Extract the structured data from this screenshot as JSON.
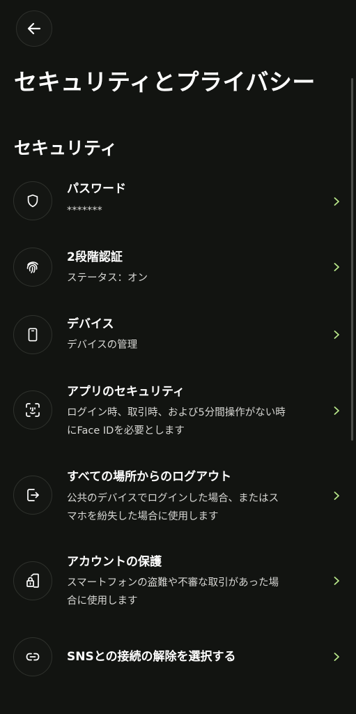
{
  "header": {
    "title": "セキュリティとプライバシー"
  },
  "section": {
    "title": "セキュリティ"
  },
  "items": [
    {
      "icon": "shield-icon",
      "title": "パスワード",
      "subtitle_lines": [
        "*******"
      ]
    },
    {
      "icon": "fingerprint-icon",
      "title": "2段階認証",
      "subtitle_lines": [
        "ステータス：オン"
      ]
    },
    {
      "icon": "phone-icon",
      "title": "デバイス",
      "subtitle_lines": [
        "デバイスの管理"
      ]
    },
    {
      "icon": "face-id-icon",
      "title": "アプリのセキュリティ",
      "subtitle_lines": [
        "ログイン時、取引時、および5分間操作がない時",
        "にFace IDを必要とします"
      ]
    },
    {
      "icon": "logout-icon",
      "title": "すべての場所からのログアウト",
      "subtitle_lines": [
        "公共のデバイスでログインした場合、またはス",
        "マホを紛失した場合に使用します"
      ]
    },
    {
      "icon": "account-protection-icon",
      "title": "アカウントの保護",
      "subtitle_lines": [
        "スマートフォンの盗難や不審な取引があった場",
        "合に使用します"
      ]
    },
    {
      "icon": "unlink-icon",
      "title": "SNSとの接続の解除を選択する",
      "subtitle_lines": []
    }
  ],
  "colors": {
    "background": "#121411",
    "chevron": "#b9e88a",
    "text": "#ffffff",
    "subtext": "#d8d8d5"
  }
}
